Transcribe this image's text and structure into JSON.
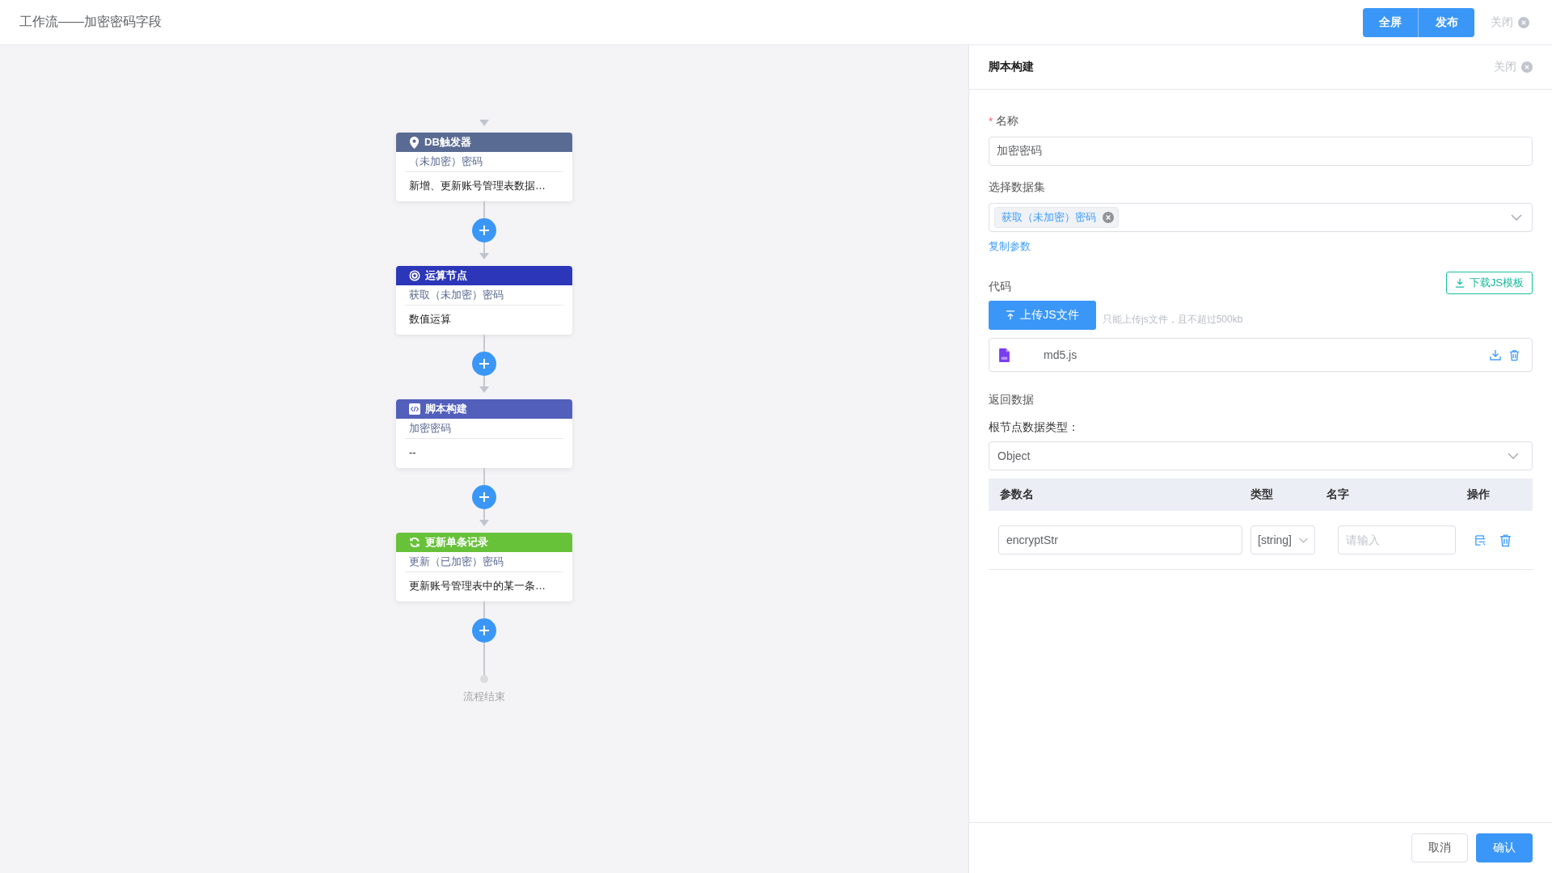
{
  "header": {
    "title": "工作流——加密密码字段",
    "buttons": [
      "全屏",
      "发布"
    ],
    "close": "关闭"
  },
  "flow": {
    "nodes": [
      {
        "kind": "trigger",
        "color": "#5a6b93",
        "title": "DB触发器",
        "subtitle": "（未加密）密码",
        "description": "新增、更新账号管理表数据…"
      },
      {
        "kind": "compute",
        "color": "#2b36b8",
        "title": "运算节点",
        "subtitle": "获取（未加密）密码",
        "description": "数值运算"
      },
      {
        "kind": "script",
        "color": "#525fbb",
        "title": "脚本构建",
        "subtitle": "加密密码",
        "description": "--"
      },
      {
        "kind": "update",
        "color": "#67c23a",
        "title": "更新单条记录",
        "subtitle": "更新（已加密）密码",
        "description": "更新账号管理表中的某一条…"
      }
    ],
    "end_label": "流程结束"
  },
  "panel": {
    "title": "脚本构建",
    "close": "关闭",
    "name": {
      "required_mark": "*",
      "label": "名称",
      "value": "加密密码"
    },
    "dataset": {
      "label": "选择数据集",
      "tags": [
        "获取（未加密）密码"
      ]
    },
    "copy_link": "复制参数",
    "code": {
      "label": "代码",
      "download_button": "下载JS模板",
      "upload_button": "上传JS文件",
      "hint": "只能上传js文件，且不超过500kb",
      "files": [
        "md5.js"
      ]
    },
    "return_section": "返回数据",
    "root_type": {
      "label": "根节点数据类型：",
      "value": "Object"
    },
    "table": {
      "columns": [
        "参数名",
        "类型",
        "名字",
        "操作"
      ],
      "rows": [
        {
          "name": "encryptStr",
          "type": "[string]",
          "label_placeholder": "请输入"
        }
      ]
    },
    "footer": {
      "cancel": "取消",
      "confirm": "确认"
    }
  }
}
